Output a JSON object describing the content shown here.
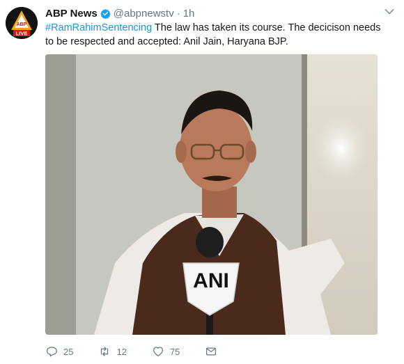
{
  "tweet": {
    "author_name": "ABP News",
    "handle": "@abpnewstv",
    "separator": "·",
    "time": "1h",
    "hashtag": "#RamRahimSentencing",
    "body": " The law has taken its course. The decicison needs to be respected and accepted: Anil Jain, Haryana BJP.",
    "avatar_text": {
      "top": "ABP",
      "bottom": "LIVE"
    },
    "media": {
      "mic_label": "ANI"
    }
  },
  "actions": {
    "reply_count": "25",
    "retweet_count": "12",
    "like_count": "75"
  },
  "colors": {
    "link": "#1b95e0",
    "muted": "#657786",
    "verified": "#1da1f2"
  },
  "icons": {
    "verified": "verified-badge-icon",
    "caret": "chevron-down-icon",
    "reply": "reply-icon",
    "retweet": "retweet-icon",
    "like": "heart-icon",
    "dm": "envelope-icon"
  }
}
